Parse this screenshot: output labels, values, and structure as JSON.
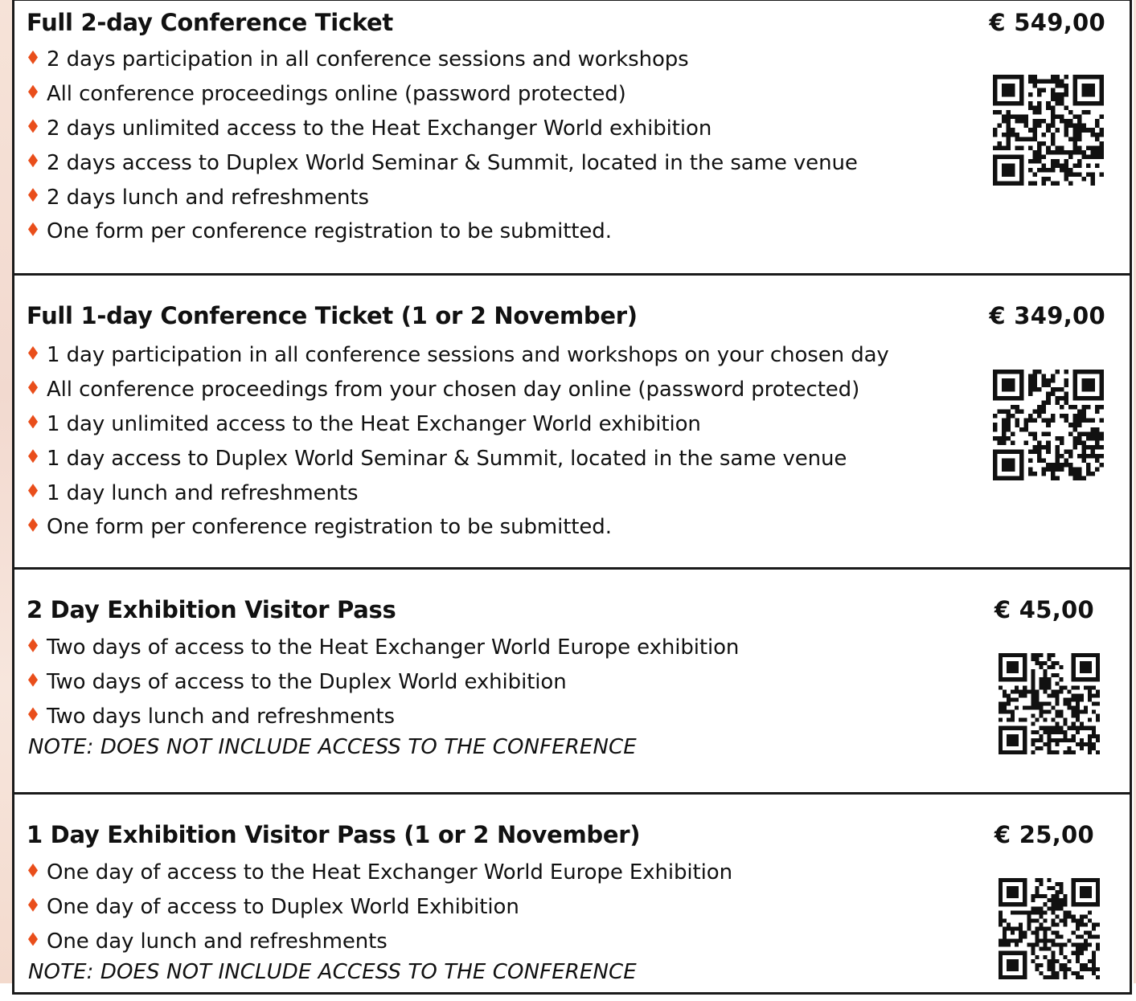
{
  "accent_color": "#e94e1b",
  "tickets": [
    {
      "title": "Full 2-day Conference Ticket",
      "price": "€ 549,00",
      "features": [
        "2 days participation in all conference sessions and workshops",
        "All conference proceedings online (password protected)",
        "2 days unlimited access to the Heat Exchanger World exhibition",
        "2 days access to Duplex World Seminar & Summit, located in the same venue",
        "2 days lunch and refreshments",
        "One form per conference registration to be submitted."
      ]
    },
    {
      "title": "Full 1-day Conference Ticket (1 or 2 November)",
      "price": "€ 349,00",
      "features": [
        "1 day participation in all conference sessions and workshops on your chosen day",
        "All conference proceedings from your chosen day online (password protected)",
        "1 day unlimited access to the Heat Exchanger World exhibition",
        "1 day access to Duplex World Seminar & Summit, located in the same venue",
        "1 day lunch and refreshments",
        "One form per conference registration to be submitted."
      ]
    },
    {
      "title": "2 Day Exhibition Visitor Pass",
      "price": "€ 45,00",
      "features": [
        "Two days of access to the Heat Exchanger World Europe exhibition",
        "Two days of access to the Duplex World exhibition",
        "Two days lunch and refreshments"
      ],
      "note": "NOTE: DOES NOT INCLUDE ACCESS TO THE CONFERENCE"
    },
    {
      "title": "1 Day Exhibition Visitor Pass  (1 or 2 November)",
      "price": "€ 25,00",
      "features": [
        "One day of access to the Heat Exchanger World Europe Exhibition",
        "One day of access to Duplex World Exhibition",
        "One day lunch and refreshments"
      ],
      "note": "NOTE: DOES NOT INCLUDE ACCESS TO THE CONFERENCE"
    }
  ]
}
